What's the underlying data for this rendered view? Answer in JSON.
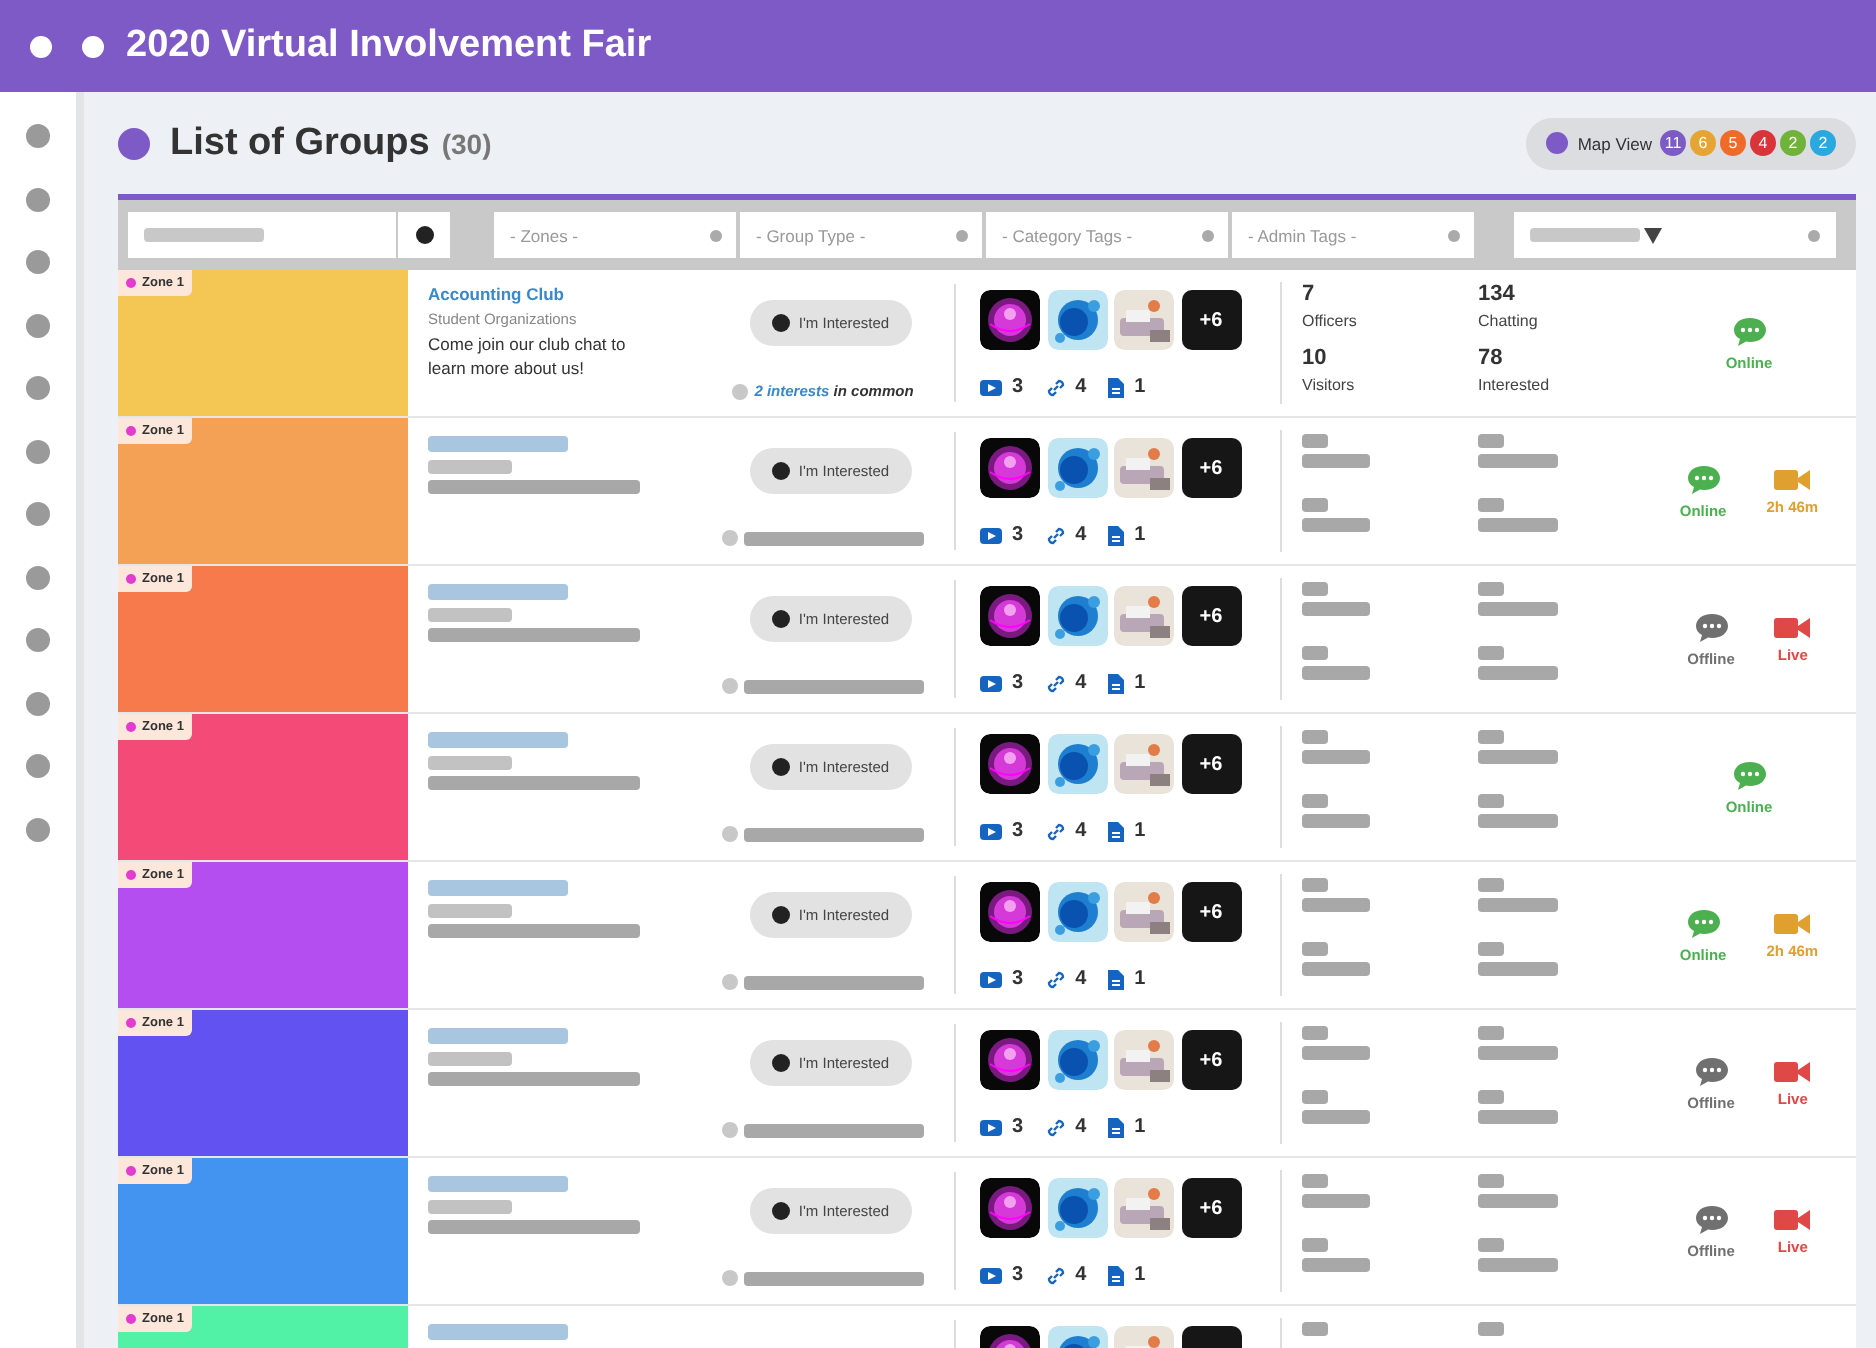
{
  "header": {
    "title": "2020 Virtual Involvement Fair"
  },
  "page": {
    "title": "List of Groups",
    "count": "(30)"
  },
  "map_view": {
    "label": "Map View",
    "badges": [
      {
        "count": "11",
        "color": "#7c5cc4"
      },
      {
        "count": "6",
        "color": "#e6a532"
      },
      {
        "count": "5",
        "color": "#f06a2a"
      },
      {
        "count": "4",
        "color": "#d9343a"
      },
      {
        "count": "2",
        "color": "#6fb33a"
      },
      {
        "count": "2",
        "color": "#2aa8e0"
      }
    ]
  },
  "filters": [
    {
      "kind": "search"
    },
    {
      "kind": "select",
      "label": "- Zones -"
    },
    {
      "kind": "select",
      "label": "- Group Type -"
    },
    {
      "kind": "select",
      "label": "- Category Tags -"
    },
    {
      "kind": "select",
      "label": "- Admin Tags -"
    },
    {
      "kind": "sort"
    }
  ],
  "rows": [
    {
      "color": "#f4c653",
      "zone": "Zone 1",
      "title": "Accounting Club",
      "category": "Student Organizations",
      "description": "Come join our club chat to learn more about us!",
      "interest_button": "I'm Interested",
      "common": {
        "count": "2 interests",
        "suffix": "in common"
      },
      "media": {
        "more": "+6",
        "videos": "3",
        "links": "4",
        "files": "1"
      },
      "stats": [
        {
          "value": "7",
          "label": "Officers"
        },
        {
          "value": "10",
          "label": "Visitors"
        },
        {
          "value": "134",
          "label": "Chatting"
        },
        {
          "value": "78",
          "label": "Interested"
        }
      ],
      "status": [
        {
          "kind": "chat",
          "color": "#4caf50",
          "label": "Online"
        }
      ]
    },
    {
      "color": "#f5a155",
      "zone": "Zone 1",
      "interest_button": "I'm Interested",
      "media": {
        "more": "+6",
        "videos": "3",
        "links": "4",
        "files": "1"
      },
      "status": [
        {
          "kind": "chat",
          "color": "#4caf50",
          "label": "Online"
        },
        {
          "kind": "video",
          "color": "#e0a030",
          "label": "2h 46m"
        }
      ]
    },
    {
      "color": "#f67a4c",
      "zone": "Zone 1",
      "interest_button": "I'm Interested",
      "media": {
        "more": "+6",
        "videos": "3",
        "links": "4",
        "files": "1"
      },
      "status": [
        {
          "kind": "chat",
          "color": "#707070",
          "label": "Offline"
        },
        {
          "kind": "video",
          "color": "#e04848",
          "label": "Live"
        }
      ]
    },
    {
      "color": "#f34a78",
      "zone": "Zone 1",
      "interest_button": "I'm Interested",
      "media": {
        "more": "+6",
        "videos": "3",
        "links": "4",
        "files": "1"
      },
      "status": [
        {
          "kind": "chat",
          "color": "#4caf50",
          "label": "Online"
        }
      ]
    },
    {
      "color": "#b54ef0",
      "zone": "Zone 1",
      "interest_button": "I'm Interested",
      "media": {
        "more": "+6",
        "videos": "3",
        "links": "4",
        "files": "1"
      },
      "status": [
        {
          "kind": "chat",
          "color": "#4caf50",
          "label": "Online"
        },
        {
          "kind": "video",
          "color": "#e0a030",
          "label": "2h 46m"
        }
      ]
    },
    {
      "color": "#6352f2",
      "zone": "Zone 1",
      "interest_button": "I'm Interested",
      "media": {
        "more": "+6",
        "videos": "3",
        "links": "4",
        "files": "1"
      },
      "status": [
        {
          "kind": "chat",
          "color": "#707070",
          "label": "Offline"
        },
        {
          "kind": "video",
          "color": "#e04848",
          "label": "Live"
        }
      ]
    },
    {
      "color": "#4394f0",
      "zone": "Zone 1",
      "interest_button": "I'm Interested",
      "media": {
        "more": "+6",
        "videos": "3",
        "links": "4",
        "files": "1"
      },
      "status": [
        {
          "kind": "chat",
          "color": "#707070",
          "label": "Offline"
        },
        {
          "kind": "video",
          "color": "#e04848",
          "label": "Live"
        }
      ]
    },
    {
      "color": "#52f2a6",
      "zone": "Zone 1",
      "media": {}
    }
  ]
}
